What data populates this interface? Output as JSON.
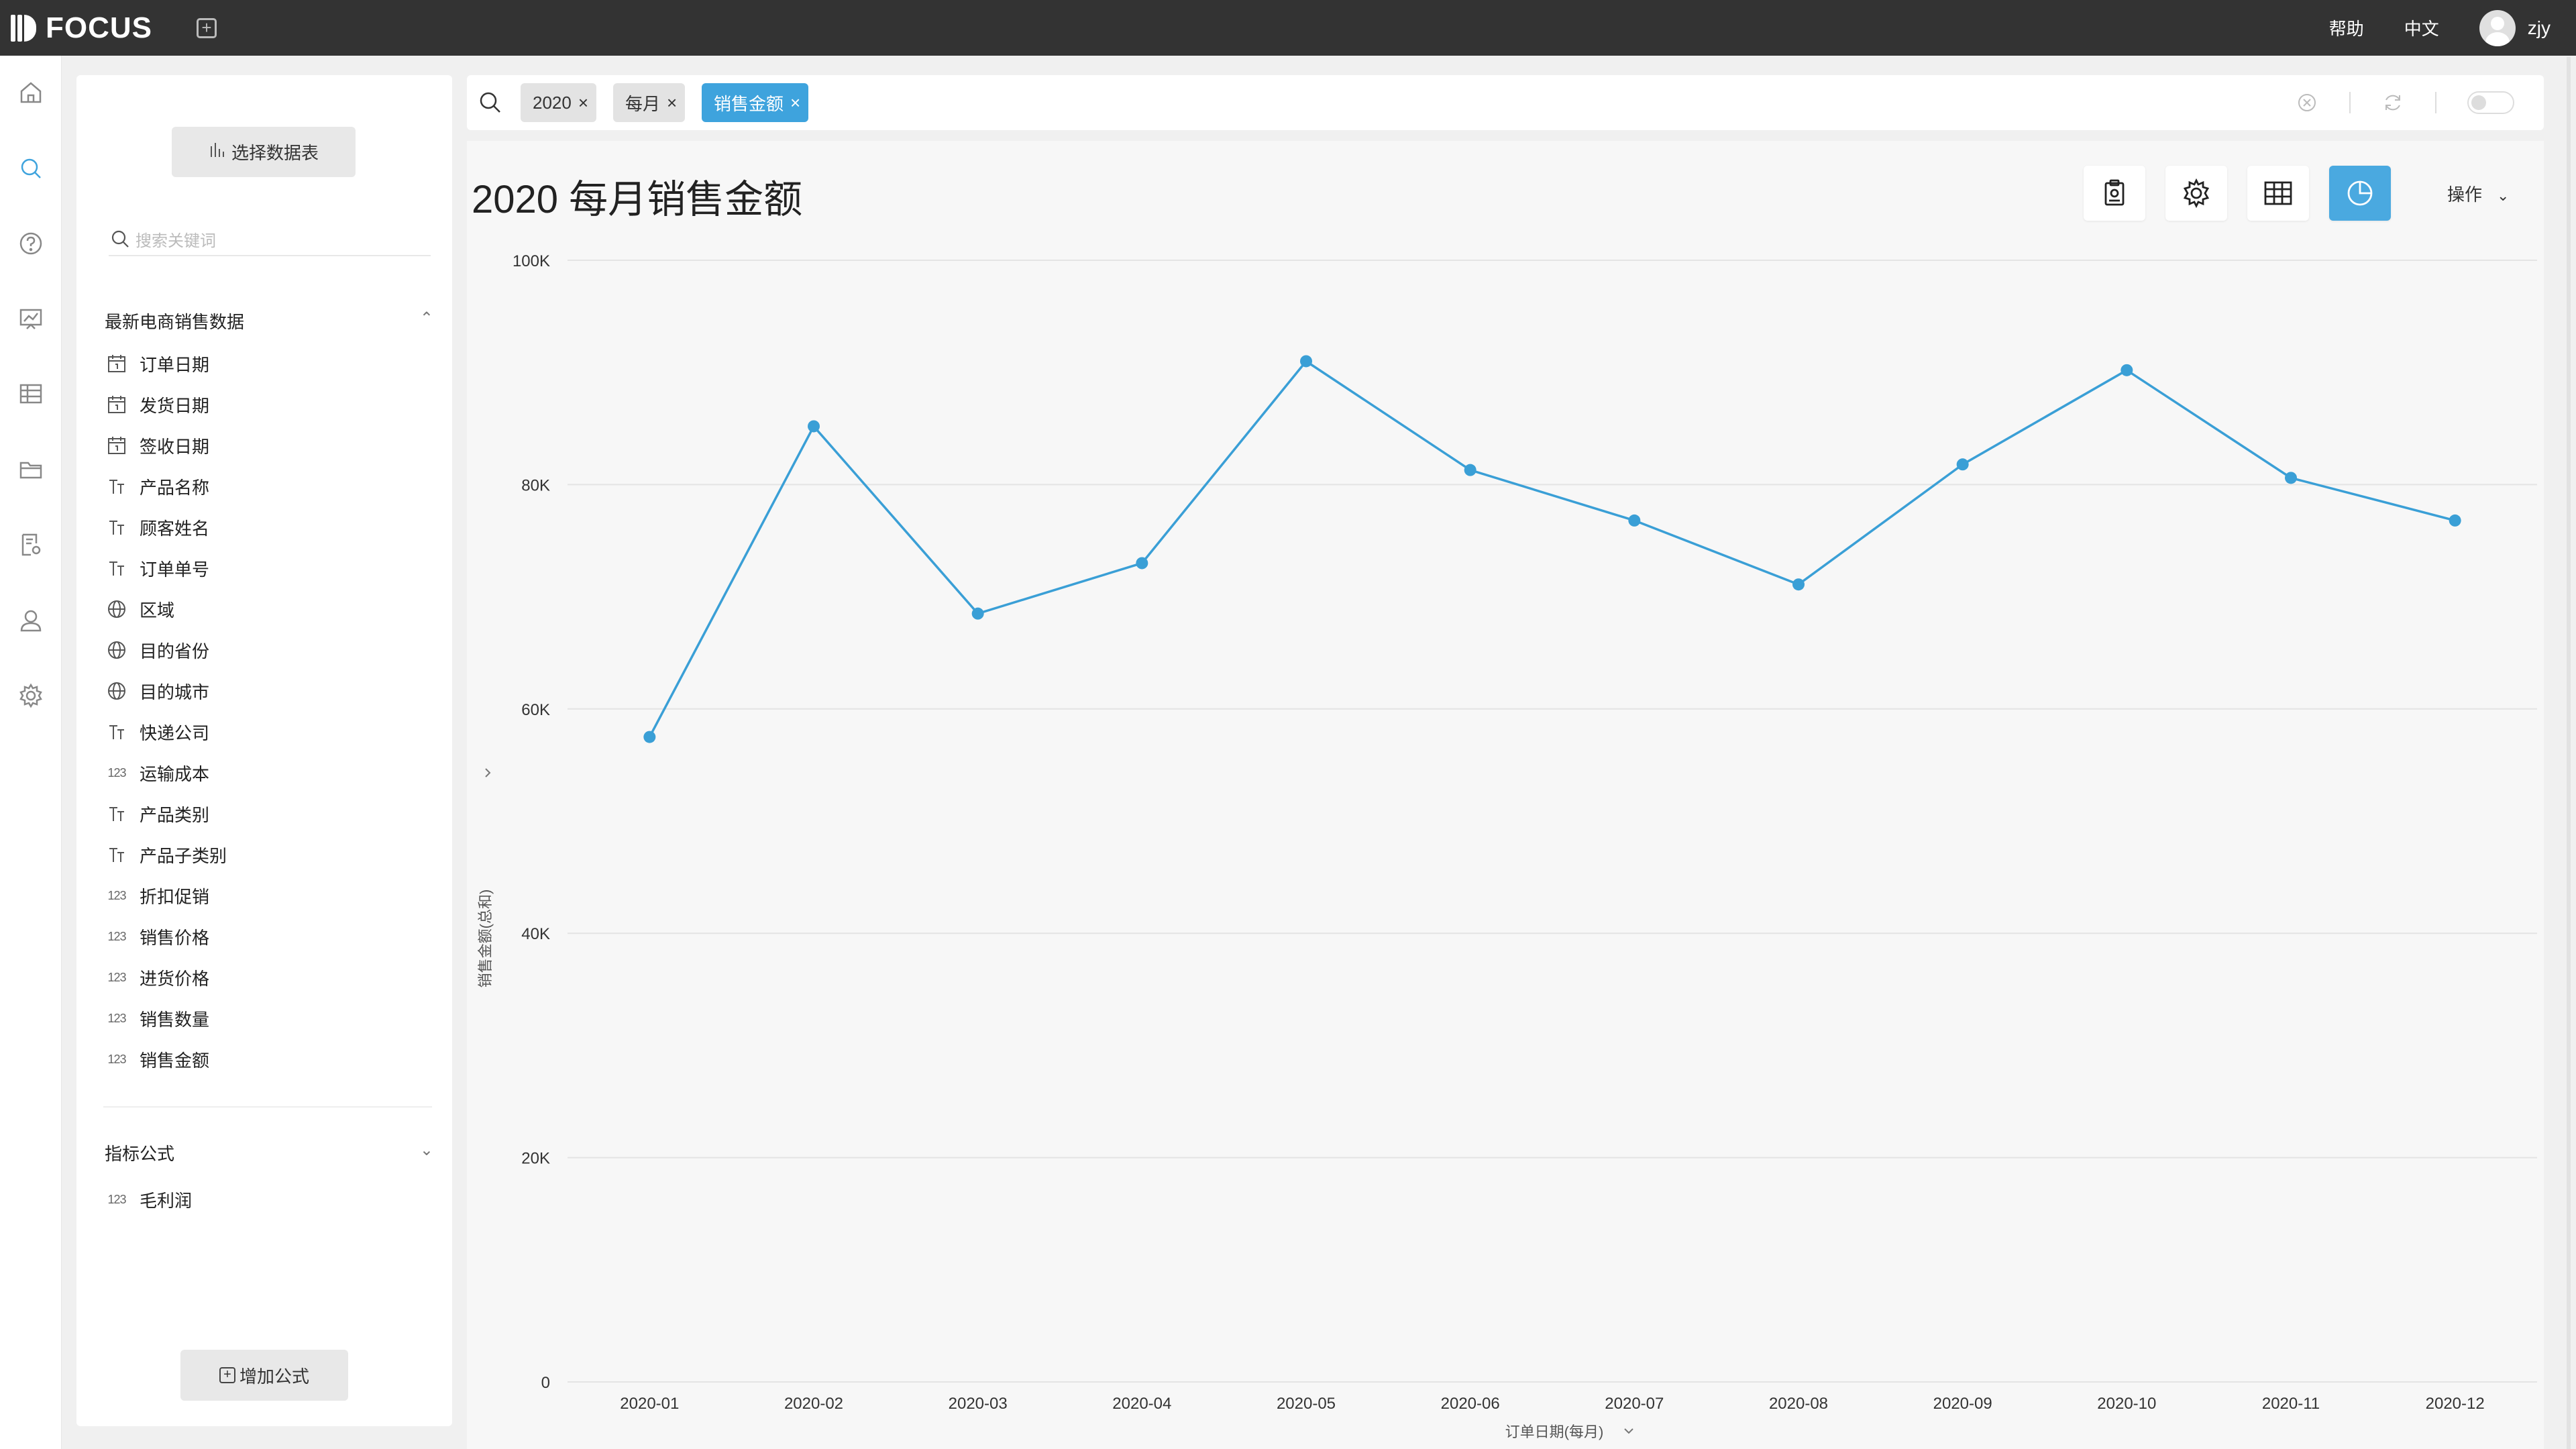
{
  "app": {
    "brand": "FOCUS"
  },
  "topbar": {
    "help": "帮助",
    "language": "中文",
    "username": "zjy"
  },
  "rail": {
    "items": [
      "home-icon",
      "search-icon",
      "help-icon",
      "dashboard-icon",
      "table-icon",
      "folder-icon",
      "report-settings-icon",
      "user-icon",
      "settings-icon"
    ]
  },
  "panel": {
    "select_table": "选择数据表",
    "search_placeholder": "搜索关键词",
    "group1": {
      "title": "最新电商销售数据",
      "fields": [
        {
          "type": "date",
          "label": "订单日期"
        },
        {
          "type": "date",
          "label": "发货日期"
        },
        {
          "type": "date",
          "label": "签收日期"
        },
        {
          "type": "text",
          "label": "产品名称"
        },
        {
          "type": "text",
          "label": "顾客姓名"
        },
        {
          "type": "text",
          "label": "订单单号"
        },
        {
          "type": "geo",
          "label": "区域"
        },
        {
          "type": "geo",
          "label": "目的省份"
        },
        {
          "type": "geo",
          "label": "目的城市"
        },
        {
          "type": "text",
          "label": "快递公司"
        },
        {
          "type": "num",
          "label": "运输成本"
        },
        {
          "type": "text",
          "label": "产品类别"
        },
        {
          "type": "text",
          "label": "产品子类别"
        },
        {
          "type": "num",
          "label": "折扣促销"
        },
        {
          "type": "num",
          "label": "销售价格"
        },
        {
          "type": "num",
          "label": "进货价格"
        },
        {
          "type": "num",
          "label": "销售数量"
        },
        {
          "type": "num",
          "label": "销售金额"
        }
      ]
    },
    "group2": {
      "title": "指标公式",
      "fields": [
        {
          "type": "num",
          "label": "毛利润"
        }
      ]
    },
    "num_glyph": "123",
    "add_formula": "增加公式"
  },
  "search": {
    "chips": [
      {
        "label": "2020",
        "style": "grey"
      },
      {
        "label": "每月",
        "style": "grey"
      },
      {
        "label": "销售金额",
        "style": "blue"
      }
    ]
  },
  "chart_header": {
    "title": "2020 每月销售金额",
    "actions_label": "操作"
  },
  "colors": {
    "accent": "#3ea3dd",
    "line": "#3a9fd6",
    "topbar": "#333333"
  },
  "chart_data": {
    "type": "line",
    "xlabel": "订单日期(每月)",
    "ylabel": "销售金额(总和)",
    "yticks": [
      "0",
      "20K",
      "40K",
      "60K",
      "80K",
      "100K"
    ],
    "ylim": [
      0,
      100000
    ],
    "categories": [
      "2020-01",
      "2020-02",
      "2020-03",
      "2020-04",
      "2020-05",
      "2020-06",
      "2020-07",
      "2020-08",
      "2020-09",
      "2020-10",
      "2020-11",
      "2020-12"
    ],
    "values": [
      57500,
      85200,
      68500,
      73000,
      91000,
      81300,
      76800,
      71100,
      81800,
      90200,
      80600,
      76800
    ],
    "grid": true
  }
}
